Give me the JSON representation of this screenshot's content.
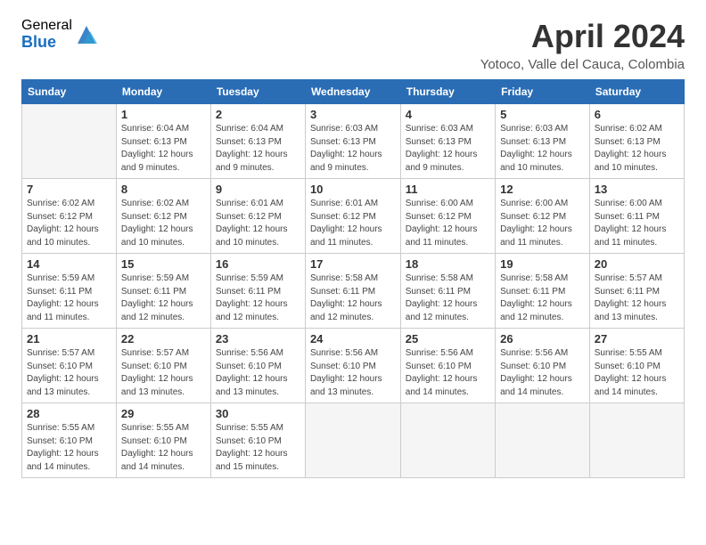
{
  "header": {
    "logo_general": "General",
    "logo_blue": "Blue",
    "month_title": "April 2024",
    "location": "Yotoco, Valle del Cauca, Colombia"
  },
  "weekdays": [
    "Sunday",
    "Monday",
    "Tuesday",
    "Wednesday",
    "Thursday",
    "Friday",
    "Saturday"
  ],
  "weeks": [
    [
      {
        "day": "",
        "sunrise": "",
        "sunset": "",
        "daylight": ""
      },
      {
        "day": "1",
        "sunrise": "Sunrise: 6:04 AM",
        "sunset": "Sunset: 6:13 PM",
        "daylight": "Daylight: 12 hours and 9 minutes."
      },
      {
        "day": "2",
        "sunrise": "Sunrise: 6:04 AM",
        "sunset": "Sunset: 6:13 PM",
        "daylight": "Daylight: 12 hours and 9 minutes."
      },
      {
        "day": "3",
        "sunrise": "Sunrise: 6:03 AM",
        "sunset": "Sunset: 6:13 PM",
        "daylight": "Daylight: 12 hours and 9 minutes."
      },
      {
        "day": "4",
        "sunrise": "Sunrise: 6:03 AM",
        "sunset": "Sunset: 6:13 PM",
        "daylight": "Daylight: 12 hours and 9 minutes."
      },
      {
        "day": "5",
        "sunrise": "Sunrise: 6:03 AM",
        "sunset": "Sunset: 6:13 PM",
        "daylight": "Daylight: 12 hours and 10 minutes."
      },
      {
        "day": "6",
        "sunrise": "Sunrise: 6:02 AM",
        "sunset": "Sunset: 6:13 PM",
        "daylight": "Daylight: 12 hours and 10 minutes."
      }
    ],
    [
      {
        "day": "7",
        "sunrise": "Sunrise: 6:02 AM",
        "sunset": "Sunset: 6:12 PM",
        "daylight": "Daylight: 12 hours and 10 minutes."
      },
      {
        "day": "8",
        "sunrise": "Sunrise: 6:02 AM",
        "sunset": "Sunset: 6:12 PM",
        "daylight": "Daylight: 12 hours and 10 minutes."
      },
      {
        "day": "9",
        "sunrise": "Sunrise: 6:01 AM",
        "sunset": "Sunset: 6:12 PM",
        "daylight": "Daylight: 12 hours and 10 minutes."
      },
      {
        "day": "10",
        "sunrise": "Sunrise: 6:01 AM",
        "sunset": "Sunset: 6:12 PM",
        "daylight": "Daylight: 12 hours and 11 minutes."
      },
      {
        "day": "11",
        "sunrise": "Sunrise: 6:00 AM",
        "sunset": "Sunset: 6:12 PM",
        "daylight": "Daylight: 12 hours and 11 minutes."
      },
      {
        "day": "12",
        "sunrise": "Sunrise: 6:00 AM",
        "sunset": "Sunset: 6:12 PM",
        "daylight": "Daylight: 12 hours and 11 minutes."
      },
      {
        "day": "13",
        "sunrise": "Sunrise: 6:00 AM",
        "sunset": "Sunset: 6:11 PM",
        "daylight": "Daylight: 12 hours and 11 minutes."
      }
    ],
    [
      {
        "day": "14",
        "sunrise": "Sunrise: 5:59 AM",
        "sunset": "Sunset: 6:11 PM",
        "daylight": "Daylight: 12 hours and 11 minutes."
      },
      {
        "day": "15",
        "sunrise": "Sunrise: 5:59 AM",
        "sunset": "Sunset: 6:11 PM",
        "daylight": "Daylight: 12 hours and 12 minutes."
      },
      {
        "day": "16",
        "sunrise": "Sunrise: 5:59 AM",
        "sunset": "Sunset: 6:11 PM",
        "daylight": "Daylight: 12 hours and 12 minutes."
      },
      {
        "day": "17",
        "sunrise": "Sunrise: 5:58 AM",
        "sunset": "Sunset: 6:11 PM",
        "daylight": "Daylight: 12 hours and 12 minutes."
      },
      {
        "day": "18",
        "sunrise": "Sunrise: 5:58 AM",
        "sunset": "Sunset: 6:11 PM",
        "daylight": "Daylight: 12 hours and 12 minutes."
      },
      {
        "day": "19",
        "sunrise": "Sunrise: 5:58 AM",
        "sunset": "Sunset: 6:11 PM",
        "daylight": "Daylight: 12 hours and 12 minutes."
      },
      {
        "day": "20",
        "sunrise": "Sunrise: 5:57 AM",
        "sunset": "Sunset: 6:11 PM",
        "daylight": "Daylight: 12 hours and 13 minutes."
      }
    ],
    [
      {
        "day": "21",
        "sunrise": "Sunrise: 5:57 AM",
        "sunset": "Sunset: 6:10 PM",
        "daylight": "Daylight: 12 hours and 13 minutes."
      },
      {
        "day": "22",
        "sunrise": "Sunrise: 5:57 AM",
        "sunset": "Sunset: 6:10 PM",
        "daylight": "Daylight: 12 hours and 13 minutes."
      },
      {
        "day": "23",
        "sunrise": "Sunrise: 5:56 AM",
        "sunset": "Sunset: 6:10 PM",
        "daylight": "Daylight: 12 hours and 13 minutes."
      },
      {
        "day": "24",
        "sunrise": "Sunrise: 5:56 AM",
        "sunset": "Sunset: 6:10 PM",
        "daylight": "Daylight: 12 hours and 13 minutes."
      },
      {
        "day": "25",
        "sunrise": "Sunrise: 5:56 AM",
        "sunset": "Sunset: 6:10 PM",
        "daylight": "Daylight: 12 hours and 14 minutes."
      },
      {
        "day": "26",
        "sunrise": "Sunrise: 5:56 AM",
        "sunset": "Sunset: 6:10 PM",
        "daylight": "Daylight: 12 hours and 14 minutes."
      },
      {
        "day": "27",
        "sunrise": "Sunrise: 5:55 AM",
        "sunset": "Sunset: 6:10 PM",
        "daylight": "Daylight: 12 hours and 14 minutes."
      }
    ],
    [
      {
        "day": "28",
        "sunrise": "Sunrise: 5:55 AM",
        "sunset": "Sunset: 6:10 PM",
        "daylight": "Daylight: 12 hours and 14 minutes."
      },
      {
        "day": "29",
        "sunrise": "Sunrise: 5:55 AM",
        "sunset": "Sunset: 6:10 PM",
        "daylight": "Daylight: 12 hours and 14 minutes."
      },
      {
        "day": "30",
        "sunrise": "Sunrise: 5:55 AM",
        "sunset": "Sunset: 6:10 PM",
        "daylight": "Daylight: 12 hours and 15 minutes."
      },
      {
        "day": "",
        "sunrise": "",
        "sunset": "",
        "daylight": ""
      },
      {
        "day": "",
        "sunrise": "",
        "sunset": "",
        "daylight": ""
      },
      {
        "day": "",
        "sunrise": "",
        "sunset": "",
        "daylight": ""
      },
      {
        "day": "",
        "sunrise": "",
        "sunset": "",
        "daylight": ""
      }
    ]
  ]
}
